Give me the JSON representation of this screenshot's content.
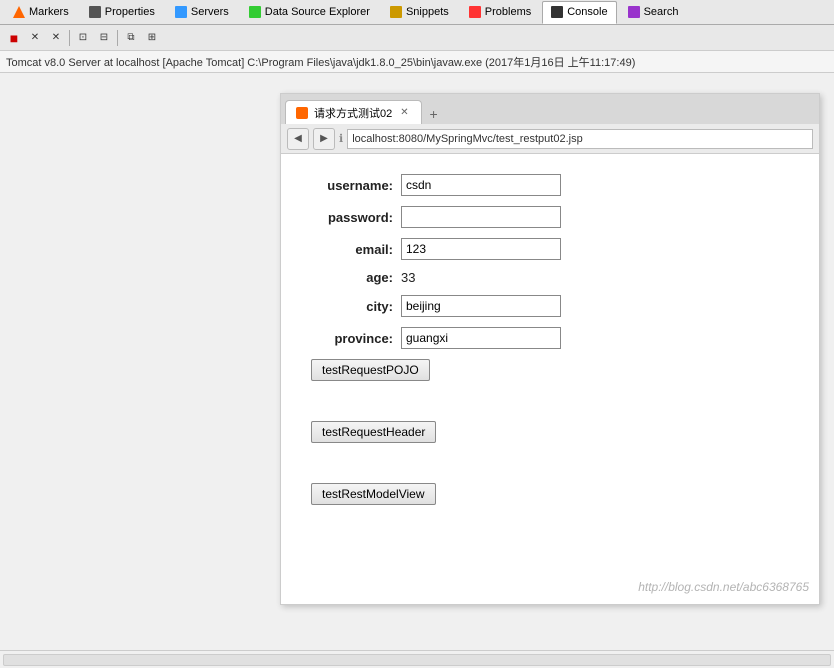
{
  "tabs": [
    {
      "id": "markers",
      "label": "Markers",
      "icon": "markers-icon",
      "active": false
    },
    {
      "id": "properties",
      "label": "Properties",
      "icon": "properties-icon",
      "active": false
    },
    {
      "id": "servers",
      "label": "Servers",
      "icon": "servers-icon",
      "active": false
    },
    {
      "id": "datasource",
      "label": "Data Source Explorer",
      "icon": "datasource-icon",
      "active": false
    },
    {
      "id": "snippets",
      "label": "Snippets",
      "icon": "snippets-icon",
      "active": false
    },
    {
      "id": "problems",
      "label": "Problems",
      "icon": "problems-icon",
      "active": false
    },
    {
      "id": "console",
      "label": "Console",
      "icon": "console-icon",
      "active": true
    },
    {
      "id": "search",
      "label": "Search",
      "icon": "search-icon",
      "active": false
    }
  ],
  "toolbar": {
    "buttons": [
      "■",
      "✕",
      "✕",
      "|",
      "⏹",
      "⏹",
      "|",
      "📋",
      "📋"
    ]
  },
  "status_bar": {
    "text": "Tomcat v8.0 Server at localhost [Apache Tomcat] C:\\Program Files\\java\\jdk1.8.0_25\\bin\\javaw.exe (2017年1月16日 上午11:17:49)"
  },
  "browser": {
    "tab_label": "请求方式测试02",
    "tab_icon": "page-icon",
    "new_tab_label": "+",
    "nav": {
      "back_label": "◀",
      "forward_label": "▶",
      "info_label": "ℹ"
    },
    "url": "localhost:8080/MySpringMvc/test_restput02.jsp",
    "form": {
      "fields": [
        {
          "label": "username:",
          "type": "input",
          "value": "csdn",
          "name": "username-input"
        },
        {
          "label": "password:",
          "type": "input",
          "value": "",
          "name": "password-input"
        },
        {
          "label": "email:",
          "type": "text-value",
          "value": "123",
          "name": "email-value"
        },
        {
          "label": "age:",
          "type": "text-value",
          "value": "33",
          "name": "age-value"
        },
        {
          "label": "city:",
          "type": "text-value",
          "value": "beijing",
          "name": "city-value"
        },
        {
          "label": "province:",
          "type": "input",
          "value": "guangxi",
          "name": "province-input"
        }
      ],
      "buttons": [
        {
          "label": "testRequestPOJO",
          "name": "test-request-pojo-button"
        },
        {
          "label": "testRequestHeader",
          "name": "test-request-header-button"
        },
        {
          "label": "testRestModelView",
          "name": "test-rest-model-view-button"
        }
      ]
    }
  },
  "watermark": {
    "text": "http://blog.csdn.net/abc6368765"
  }
}
